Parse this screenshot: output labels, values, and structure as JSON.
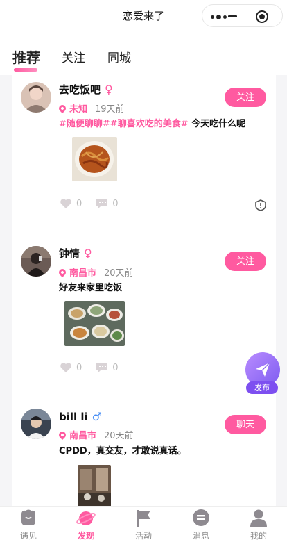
{
  "header": {
    "title": "恋爱来了"
  },
  "tabs": [
    {
      "label": "推荐",
      "active": true
    },
    {
      "label": "关注",
      "active": false
    },
    {
      "label": "同城",
      "active": false
    }
  ],
  "posts": [
    {
      "name": "去吃饭吧",
      "gender": "♀",
      "location": "未知",
      "time": "19天前",
      "tags": [
        "#随便聊聊#",
        "#聊喜欢吃的美食#"
      ],
      "text": "今天吃什么呢",
      "likes": "0",
      "comments": "0",
      "button": "关注"
    },
    {
      "name": "钟情",
      "gender": "♀",
      "location": "南昌市",
      "time": "20天前",
      "tags": [],
      "text": "好友来家里吃饭",
      "likes": "0",
      "comments": "0",
      "button": "关注"
    },
    {
      "name": "bill li",
      "gender": "♂",
      "location": "南昌市",
      "time": "20天前",
      "tags": [],
      "text": "CPDD，真交友，才敢说真话。",
      "button": "聊天"
    }
  ],
  "fab": {
    "label": "发布"
  },
  "nav": [
    {
      "label": "遇见",
      "icon": "meet-icon",
      "active": false
    },
    {
      "label": "发现",
      "icon": "planet-icon",
      "active": true
    },
    {
      "label": "活动",
      "icon": "flag-icon",
      "active": false
    },
    {
      "label": "消息",
      "icon": "message-icon",
      "active": false
    },
    {
      "label": "我的",
      "icon": "user-icon",
      "active": false
    }
  ],
  "colors": {
    "accent": "#ff5aa0",
    "fab": "#7d5cf0",
    "male": "#4a8ff5"
  }
}
